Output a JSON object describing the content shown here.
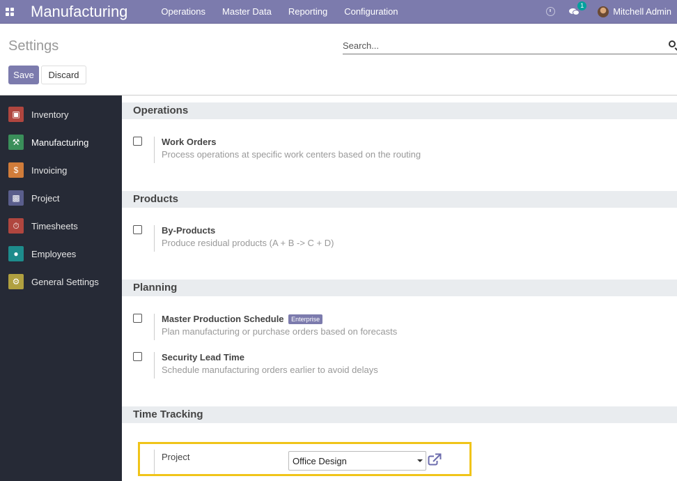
{
  "navbar": {
    "app_title": "Manufacturing",
    "menus": [
      "Operations",
      "Master Data",
      "Reporting",
      "Configuration"
    ],
    "chat_count": "1",
    "user_name": "Mitchell Admin"
  },
  "control_panel": {
    "title": "Settings",
    "search_placeholder": "Search...",
    "save_label": "Save",
    "discard_label": "Discard"
  },
  "sidebar": {
    "items": [
      {
        "label": "Inventory",
        "icon": "box-icon",
        "color": "#b0463f"
      },
      {
        "label": "Manufacturing",
        "icon": "wrench-icon",
        "color": "#3a8f5a"
      },
      {
        "label": "Invoicing",
        "icon": "invoice-icon",
        "color": "#d07c3a"
      },
      {
        "label": "Project",
        "icon": "puzzle-icon",
        "color": "#5a5e8c"
      },
      {
        "label": "Timesheets",
        "icon": "stopwatch-icon",
        "color": "#b0463f"
      },
      {
        "label": "Employees",
        "icon": "users-icon",
        "color": "#1d8c8c"
      },
      {
        "label": "General Settings",
        "icon": "gear-icon",
        "color": "#b0a040"
      }
    ],
    "active": "Manufacturing"
  },
  "sections": [
    {
      "title": "Operations",
      "settings": [
        {
          "title": "Work Orders",
          "description": "Process operations at specific work centers based on the routing",
          "checked": false
        }
      ]
    },
    {
      "title": "Products",
      "settings": [
        {
          "title": "By-Products",
          "description": "Produce residual products (A + B -> C + D)",
          "checked": false
        }
      ]
    },
    {
      "title": "Planning",
      "settings": [
        {
          "title": "Master Production Schedule",
          "badge": "Enterprise",
          "description": "Plan manufacturing or purchase orders based on forecasts",
          "checked": false
        },
        {
          "title": "Security Lead Time",
          "description": "Schedule manufacturing orders earlier to avoid delays",
          "checked": false
        }
      ]
    },
    {
      "title": "Time Tracking",
      "settings": []
    }
  ],
  "time_tracking": {
    "project_label": "Project",
    "project_value": "Office Design"
  },
  "colors": {
    "brand": "#7c7bad",
    "sidebar_bg": "#262a36",
    "highlight": "#f0c419"
  }
}
